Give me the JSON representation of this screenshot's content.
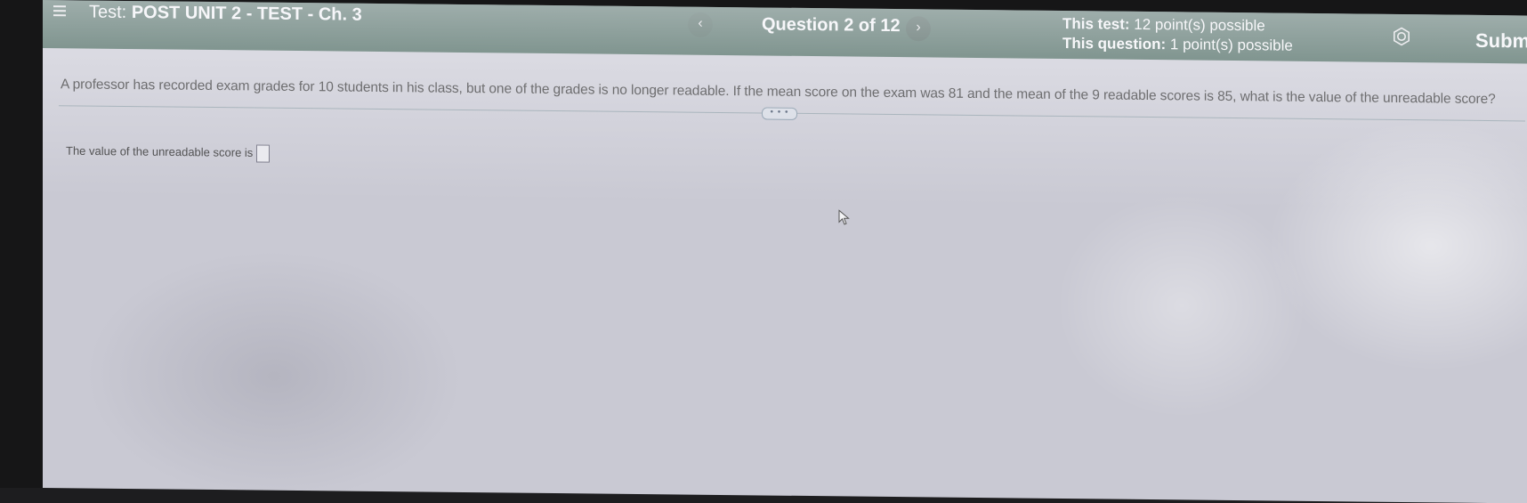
{
  "header": {
    "title_prefix": "Test:",
    "title": "POST UNIT 2 - TEST - Ch. 3",
    "prev_label": "‹",
    "question_label": "Question 2 of 12",
    "next_label": "›",
    "this_test_label": "This test:",
    "this_test_value": "12 point(s) possible",
    "this_question_label": "This question:",
    "this_question_value": "1 point(s) possible",
    "submit_label": "Submi",
    "icons": {
      "menu": "menu-icon",
      "settings": "gear-icon"
    },
    "colors": {
      "bar": "#244a3c",
      "text": "#ffffff"
    }
  },
  "question": {
    "text": "A professor has recorded exam grades for 10 students in his class, but one of the grades is no longer readable. If the mean score on the exam was 81 and the mean of the 9 readable scores is 85, what is the value of the unreadable score?",
    "more_label": "• • •",
    "answer_prompt": "The value of the unreadable score is",
    "answer_value": ""
  }
}
